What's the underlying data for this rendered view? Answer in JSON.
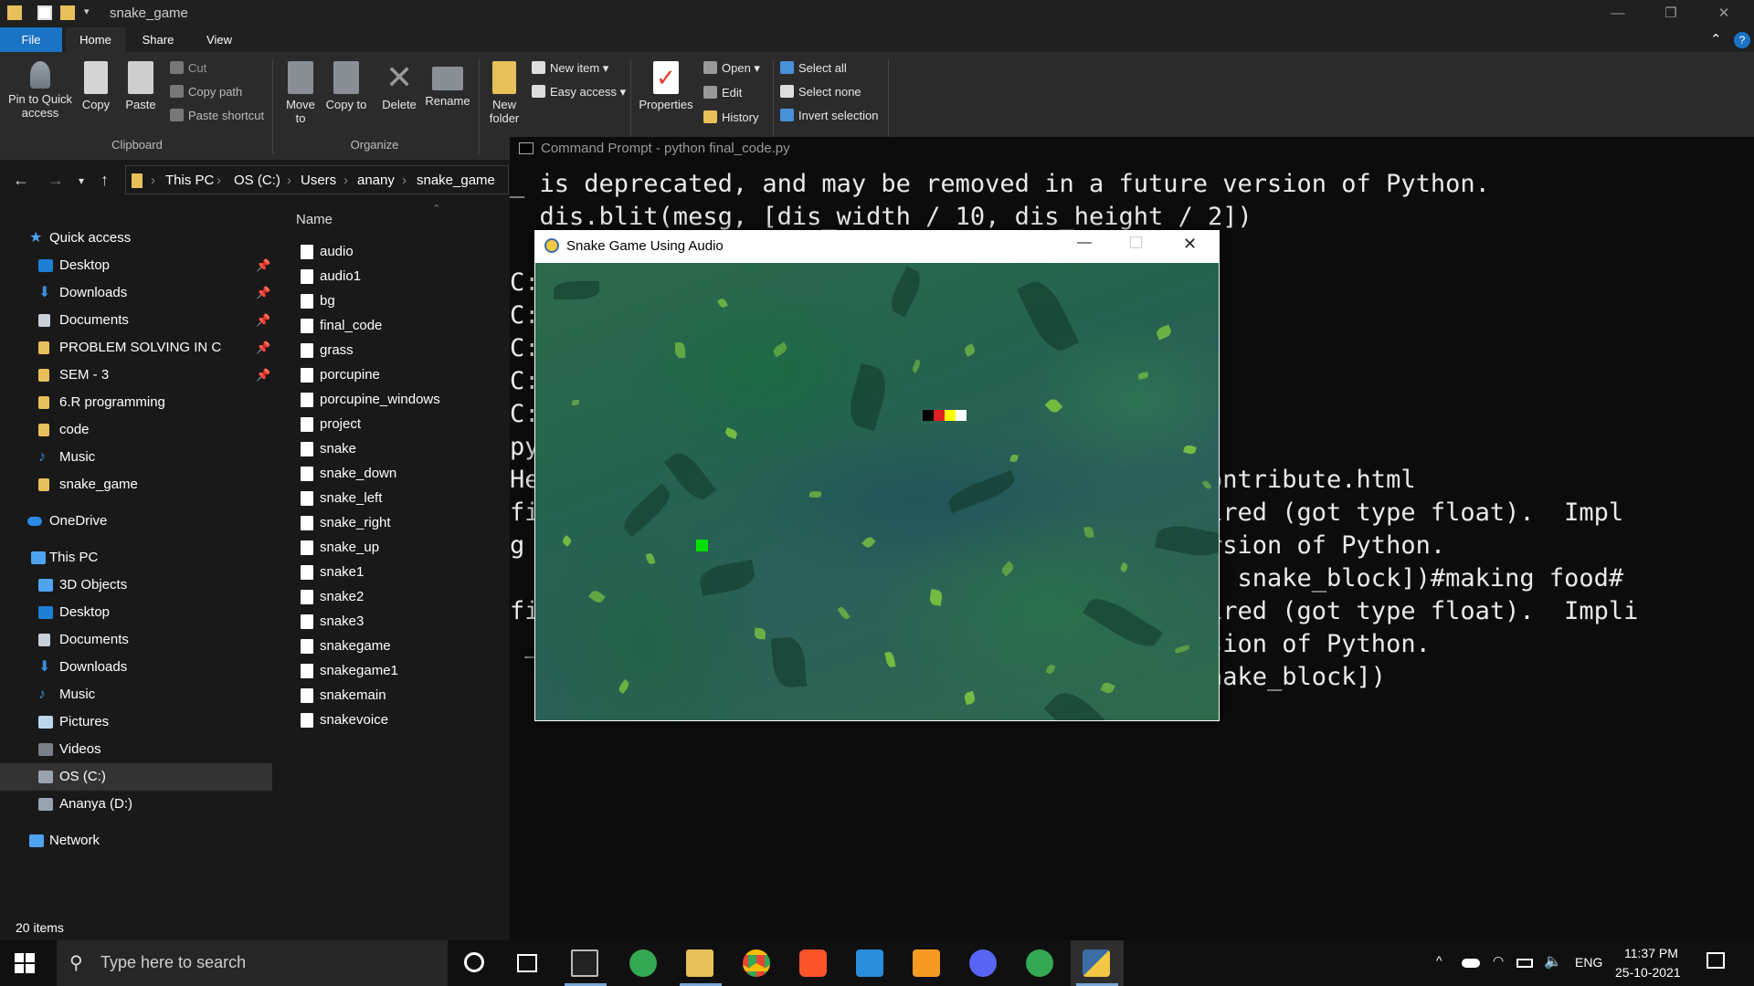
{
  "explorer": {
    "title": "snake_game",
    "tabs": [
      "File",
      "Home",
      "Share",
      "View"
    ],
    "ribbon": {
      "pin_label": "Pin to Quick access",
      "copy_label": "Copy",
      "paste_label": "Paste",
      "cut_label": "Cut",
      "copy_path_label": "Copy path",
      "paste_shortcut_label": "Paste shortcut",
      "clipboard_group": "Clipboard",
      "move_to_label": "Move to",
      "copy_to_label": "Copy to",
      "delete_label": "Delete",
      "rename_label": "Rename",
      "organize_group": "Organize",
      "new_folder_label": "New folder",
      "new_item_label": "New item",
      "easy_access_label": "Easy access",
      "properties_label": "Properties",
      "open_label": "Open",
      "edit_label": "Edit",
      "history_label": "History",
      "select_all_label": "Select all",
      "select_none_label": "Select none",
      "invert_selection_label": "Invert selection"
    },
    "breadcrumb": [
      "This PC",
      "OS (C:)",
      "Users",
      "anany",
      "snake_game"
    ],
    "nav": {
      "quick_access": "Quick access",
      "quick_items": [
        "Desktop",
        "Downloads",
        "Documents",
        "PROBLEM SOLVING IN C",
        "SEM - 3",
        "6.R programming",
        "code",
        "Music",
        "snake_game"
      ],
      "onedrive": "OneDrive",
      "this_pc": "This PC",
      "pc_items": [
        "3D Objects",
        "Desktop",
        "Documents",
        "Downloads",
        "Music",
        "Pictures",
        "Videos",
        "OS (C:)",
        "Ananya (D:)"
      ],
      "network": "Network"
    },
    "column_header": "Name",
    "files": [
      "audio",
      "audio1",
      "bg",
      "final_code",
      "grass",
      "porcupine",
      "porcupine_windows",
      "project",
      "snake",
      "snake_down",
      "snake_left",
      "snake_right",
      "snake_up",
      "snake1",
      "snake2",
      "snake3",
      "snakegame",
      "snakegame1",
      "snakemain",
      "snakevoice"
    ],
    "status": "20 items"
  },
  "cmd": {
    "title": "Command Prompt - python  final_code.py",
    "lines": [
      "_ is deprecated, and may be removed in a future version of Python.",
      "  dis.blit(mesg, [dis_width / 10, dis_height / 2])",
      "C:",
      "C:",
      "C:",
      "C:",
      "C:",
      "py",
      "He                                    ame.org/contribute.html",
      "fi                                    r is required (got type float).  Impl",
      "g                                     future version of Python.",
      "                                      ake_block, snake_block])#making food#",
      "fi                                    r is required (got type float).  Impli",
      " _                                   future version of Python.",
      "                                      _block, snake_block])"
    ]
  },
  "game": {
    "title": "Snake Game Using Audio",
    "snake_colors": [
      "#000000",
      "#e02020",
      "#ffff00",
      "#ffffff"
    ],
    "food_color": "#00e000"
  },
  "taskbar": {
    "search_placeholder": "Type here to search",
    "language": "ENG",
    "time": "11:37 PM",
    "date": "25-10-2021"
  }
}
